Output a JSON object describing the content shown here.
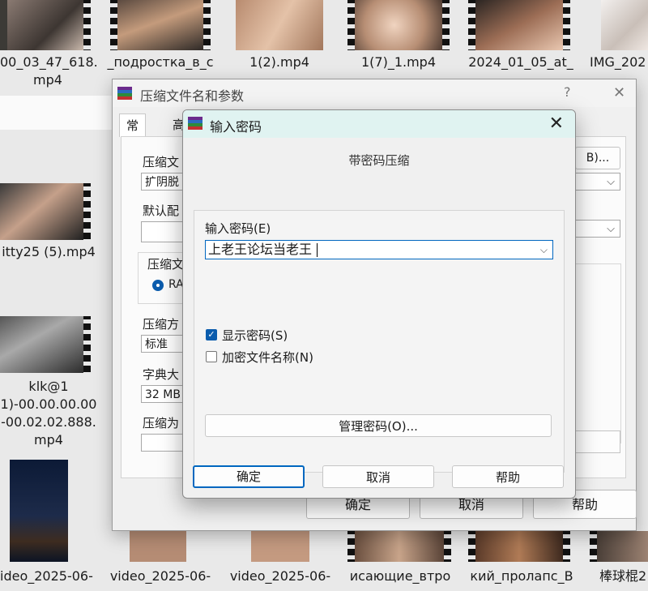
{
  "explorer": {
    "files": [
      {
        "name_lines": [
          "00_03_47_618.",
          "mp4"
        ]
      },
      {
        "name_lines": [
          "_подростка_в_с"
        ]
      },
      {
        "name_lines": [
          "1(2).mp4"
        ]
      },
      {
        "name_lines": [
          "1(7)_1.mp4"
        ]
      },
      {
        "name_lines": [
          "2024_01_05_at_"
        ]
      },
      {
        "name_lines": [
          "IMG_202"
        ]
      },
      {
        "name_lines": [
          "itty25 (5).mp4"
        ]
      },
      {
        "name_lines": [
          "klk@1",
          "1)-00.00.00.00",
          "-00.02.02.888.",
          "mp4"
        ]
      },
      {
        "name_lines": [
          "ideo_2025-06-"
        ]
      },
      {
        "name_lines": [
          "video_2025-06-"
        ]
      },
      {
        "name_lines": [
          "video_2025-06-"
        ]
      },
      {
        "name_lines": [
          "исающие_втро"
        ]
      },
      {
        "name_lines": [
          "кий_пролапс_В"
        ]
      },
      {
        "name_lines": [
          "棒球棍2"
        ]
      }
    ]
  },
  "archive_dialog": {
    "title": "压缩文件名和参数",
    "help_glyph": "?",
    "close_glyph": "✕",
    "tabs": [
      "常规",
      "高"
    ],
    "labels": {
      "archive_name": "压缩文",
      "default_profile": "默认配",
      "format": "压缩文",
      "format_option": "RA",
      "method": "压缩方",
      "dict_size": "字典大",
      "split": "压缩为"
    },
    "values": {
      "archive_name": "扩阴脱",
      "method": "标准",
      "dict_size": "32 MB"
    },
    "browse_button": "B)...",
    "buttons": {
      "ok": "确定",
      "cancel": "取消",
      "help": "帮助"
    }
  },
  "password_dialog": {
    "title": "输入密码",
    "close_glyph": "✕",
    "heading": "带密码压缩",
    "password_label": "输入密码(E)",
    "password_value": "上老王论坛当老王",
    "show_password_label": "显示密码(S)",
    "show_password_checked": true,
    "encrypt_names_label": "加密文件名称(N)",
    "encrypt_names_checked": false,
    "manage_button": "管理密码(O)...",
    "buttons": {
      "ok": "确定",
      "cancel": "取消",
      "help": "帮助"
    }
  },
  "colors": {
    "accent": "#0067c0",
    "title_bar_front": "#e0f3f1"
  }
}
